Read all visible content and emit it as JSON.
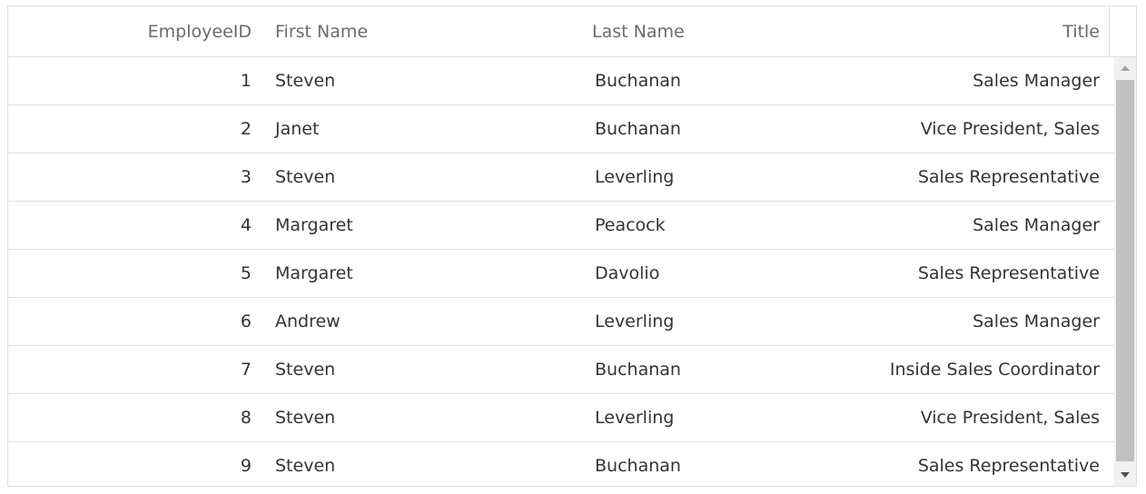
{
  "grid": {
    "columns": {
      "employee_id": "EmployeeID",
      "first_name": "First Name",
      "last_name": "Last Name",
      "title": "Title"
    },
    "rows": [
      {
        "employee_id": "1",
        "first_name": "Steven",
        "last_name": "Buchanan",
        "title": "Sales Manager"
      },
      {
        "employee_id": "2",
        "first_name": "Janet",
        "last_name": "Buchanan",
        "title": "Vice President, Sales"
      },
      {
        "employee_id": "3",
        "first_name": "Steven",
        "last_name": "Leverling",
        "title": "Sales Representative"
      },
      {
        "employee_id": "4",
        "first_name": "Margaret",
        "last_name": "Peacock",
        "title": "Sales Manager"
      },
      {
        "employee_id": "5",
        "first_name": "Margaret",
        "last_name": "Davolio",
        "title": "Sales Representative"
      },
      {
        "employee_id": "6",
        "first_name": "Andrew",
        "last_name": "Leverling",
        "title": "Sales Manager"
      },
      {
        "employee_id": "7",
        "first_name": "Steven",
        "last_name": "Buchanan",
        "title": "Inside Sales Coordinator"
      },
      {
        "employee_id": "8",
        "first_name": "Steven",
        "last_name": "Leverling",
        "title": "Vice President, Sales"
      },
      {
        "employee_id": "9",
        "first_name": "Steven",
        "last_name": "Buchanan",
        "title": "Sales Representative"
      }
    ]
  },
  "scrollbar": {
    "up_icon": "arrow-up-icon",
    "down_icon": "arrow-down-icon"
  },
  "colors": {
    "border": "#e0e0e0",
    "header_text": "#6b6b6b",
    "cell_text": "#333333",
    "scroll_thumb": "#c1c1c1"
  }
}
